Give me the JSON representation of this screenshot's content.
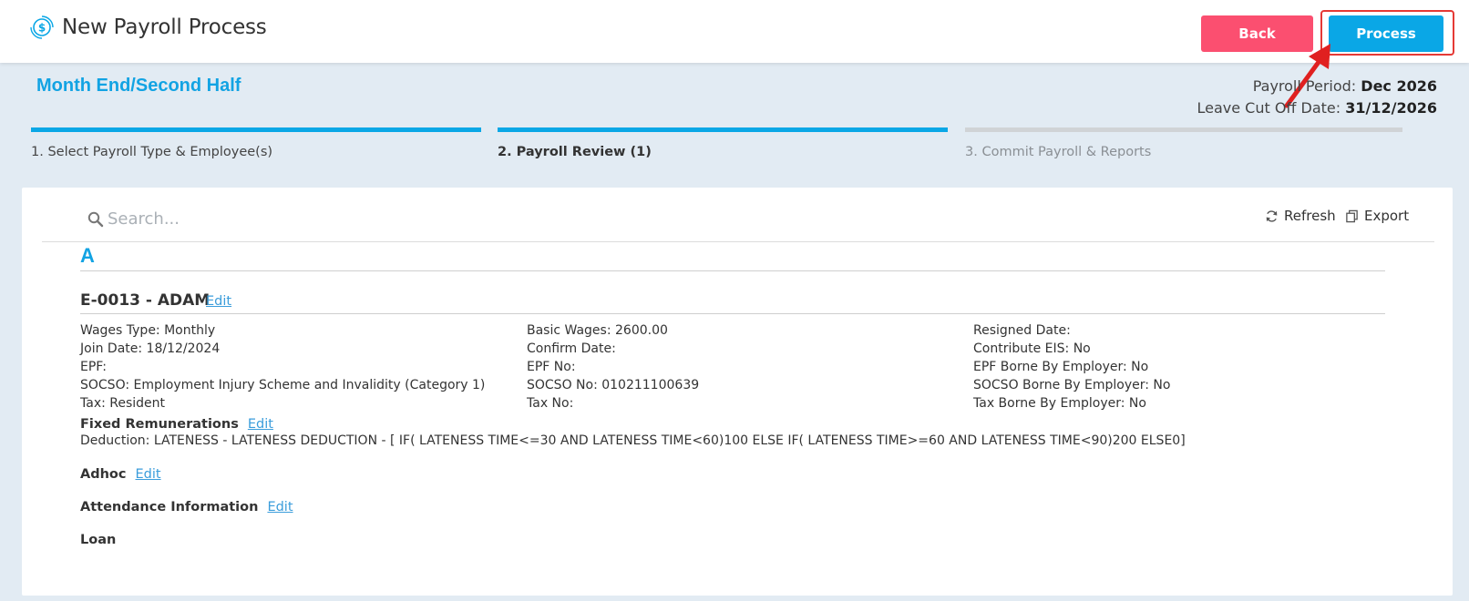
{
  "header": {
    "title": "New Payroll Process",
    "back_label": "Back",
    "process_label": "Process"
  },
  "payroll": {
    "type": "Month End/Second Half",
    "period_label": "Payroll Period:",
    "period_value": "Dec 2026",
    "leave_label": "Leave Cut Off Date:",
    "leave_value": "31/12/2026"
  },
  "steps": [
    {
      "label": "1. Select Payroll Type & Employee(s)",
      "state": "done"
    },
    {
      "label": "2. Payroll Review (1)",
      "state": "active"
    },
    {
      "label": "3. Commit Payroll & Reports",
      "state": "inactive"
    }
  ],
  "toolbar": {
    "search_placeholder": "Search...",
    "refresh_label": "Refresh",
    "export_label": "Export"
  },
  "group_letter": "A",
  "employee": {
    "name": "E-0013 - ADAM",
    "edit_label": "Edit",
    "col1": [
      "Wages Type: Monthly",
      "Join Date: 18/12/2024",
      "EPF:",
      "SOCSO: Employment Injury Scheme and Invalidity (Category 1)",
      "Tax: Resident"
    ],
    "col2": [
      "Basic Wages: 2600.00",
      "Confirm Date:",
      "EPF No:",
      "SOCSO No: 010211100639",
      "Tax No:"
    ],
    "col3": [
      "Resigned Date:",
      "Contribute EIS: No",
      "EPF Borne By Employer: No",
      "SOCSO Borne By Employer: No",
      "Tax Borne By Employer: No"
    ]
  },
  "sections": {
    "fixed": {
      "title": "Fixed Remunerations",
      "edit_label": "Edit",
      "line": "Deduction: LATENESS - LATENESS DEDUCTION - [ IF( LATENESS TIME<=30 AND LATENESS TIME<60)100 ELSE IF( LATENESS TIME>=60 AND LATENESS TIME<90)200 ELSE0]"
    },
    "adhoc": {
      "title": "Adhoc",
      "edit_label": "Edit"
    },
    "attendance": {
      "title": "Attendance Information",
      "edit_label": "Edit"
    },
    "loan": {
      "title": "Loan"
    }
  },
  "colors": {
    "accent": "#0aa7e6",
    "back_button": "#fb4f70",
    "highlight": "#e53935"
  }
}
